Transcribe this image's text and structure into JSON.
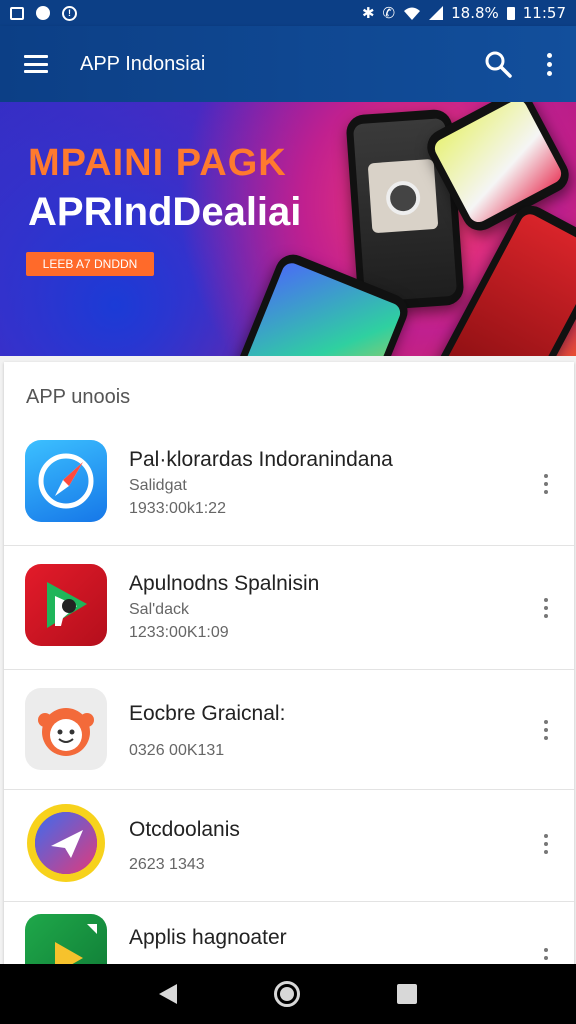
{
  "status_bar": {
    "battery": "18.8%",
    "time": "11:57"
  },
  "app_bar": {
    "title": "APP Indonsiai",
    "menu_icon": "hamburger-menu-icon",
    "search_icon": "search-icon",
    "overflow_icon": "more-vert-icon"
  },
  "banner": {
    "headline": "MPAINI PAGK",
    "subheadline": "APRIndDealiai",
    "button_label": "LEEB A7 DNDDN"
  },
  "list": {
    "section_title": "APP unoois",
    "items": [
      {
        "name": "Pal·klorardas Indoranindana",
        "line1": "Salidgat",
        "line2": "1933:00k1:22",
        "icon": "compass-app-icon"
      },
      {
        "name": "Apulnodns Spalnisin",
        "line1": "Sal'dack",
        "line2": "1233:00K1:09",
        "icon": "play-store-app-icon"
      },
      {
        "name": "Eocbre Graicnal:",
        "line1": "",
        "line2": "0326 00K131",
        "icon": "smiley-app-icon"
      },
      {
        "name": "Otcdoolanis",
        "line1": "",
        "line2": "2623 1343",
        "icon": "plane-app-icon"
      },
      {
        "name": "Applis hagnoater",
        "line1": "",
        "line2": "",
        "icon": "media-app-icon"
      }
    ]
  },
  "colors": {
    "primary": "#0c3f86",
    "accent": "#ff6a2a"
  },
  "nav_bar": {
    "back_icon": "back-triangle-icon",
    "home_icon": "home-circle-icon",
    "recent_icon": "recent-square-icon"
  }
}
